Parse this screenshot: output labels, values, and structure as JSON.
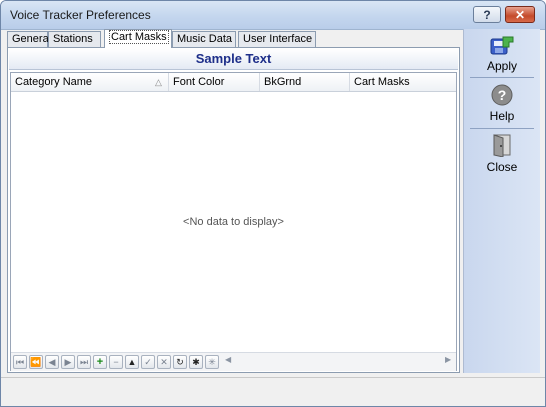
{
  "window": {
    "title": "Voice Tracker Preferences"
  },
  "titlebar_buttons": {
    "help_label": "?",
    "close_label": "✕"
  },
  "tabs": [
    {
      "label": "General"
    },
    {
      "label": "Stations"
    },
    {
      "label": "Cart Masks",
      "active": true
    },
    {
      "label": "Music Data"
    },
    {
      "label": "User Interface"
    }
  ],
  "panel": {
    "sample_text": "Sample Text",
    "columns": [
      "Category Name",
      "Font Color",
      "BkGrnd",
      "Cart Masks"
    ],
    "empty_message": "<No data to display>"
  },
  "sidebar": {
    "apply": {
      "label": "Apply",
      "icon": "apply-icon"
    },
    "help": {
      "label": "Help",
      "icon": "help-icon"
    },
    "close": {
      "label": "Close",
      "icon": "door-icon"
    }
  },
  "colors": {
    "sample_text": "#1e2f8a",
    "sidebar": "#c9d7ee",
    "add_green": "#1a8a1a"
  }
}
